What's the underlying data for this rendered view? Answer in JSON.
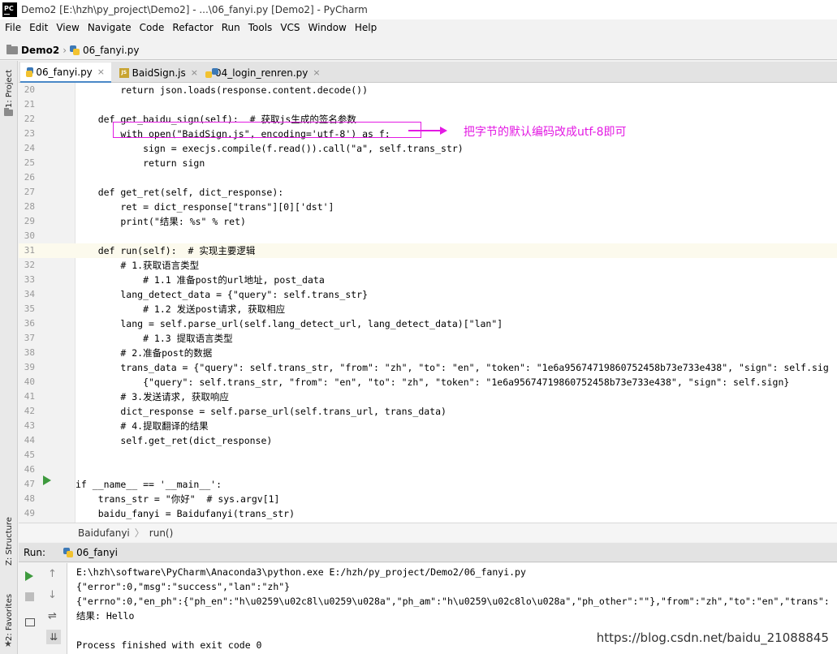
{
  "window": {
    "title": "Demo2 [E:\\hzh\\py_project\\Demo2] - ...\\06_fanyi.py [Demo2] - PyCharm"
  },
  "menu": [
    "File",
    "Edit",
    "View",
    "Navigate",
    "Code",
    "Refactor",
    "Run",
    "Tools",
    "VCS",
    "Window",
    "Help"
  ],
  "breadcrumb": {
    "project": "Demo2",
    "file": "06_fanyi.py"
  },
  "side_tools": {
    "project": "1: Project",
    "structure": "Z: Structure",
    "favorites": "2: Favorites"
  },
  "tabs": [
    {
      "label": "06_fanyi.py",
      "close": "×"
    },
    {
      "label": "BaidSign.js",
      "close": "×"
    },
    {
      "label": "04_login_renren.py",
      "close": "×"
    }
  ],
  "code_lines": [
    {
      "n": "20",
      "text": "        return json.loads(response.content.decode())"
    },
    {
      "n": "21",
      "text": ""
    },
    {
      "n": "22",
      "text": "    def get_baidu_sign(self):  # 获取js生成的签名参数"
    },
    {
      "n": "23",
      "text": "        with open(\"BaidSign.js\", encoding='utf-8') as f:"
    },
    {
      "n": "24",
      "text": "            sign = execjs.compile(f.read()).call(\"a\", self.trans_str)"
    },
    {
      "n": "25",
      "text": "            return sign"
    },
    {
      "n": "26",
      "text": ""
    },
    {
      "n": "27",
      "text": "    def get_ret(self, dict_response):"
    },
    {
      "n": "28",
      "text": "        ret = dict_response[\"trans\"][0]['dst']"
    },
    {
      "n": "29",
      "text": "        print(\"结果: %s\" % ret)"
    },
    {
      "n": "30",
      "text": ""
    },
    {
      "n": "31",
      "text": "    def run(self):  # 实现主要逻辑"
    },
    {
      "n": "32",
      "text": "        # 1.获取语言类型"
    },
    {
      "n": "33",
      "text": "            # 1.1 准备post的url地址, post_data"
    },
    {
      "n": "34",
      "text": "        lang_detect_data = {\"query\": self.trans_str}"
    },
    {
      "n": "35",
      "text": "            # 1.2 发送post请求, 获取相应"
    },
    {
      "n": "36",
      "text": "        lang = self.parse_url(self.lang_detect_url, lang_detect_data)[\"lan\"]"
    },
    {
      "n": "37",
      "text": "            # 1.3 提取语言类型"
    },
    {
      "n": "38",
      "text": "        # 2.准备post的数据"
    },
    {
      "n": "39",
      "text": "        trans_data = {\"query\": self.trans_str, \"from\": \"zh\", \"to\": \"en\", \"token\": \"1e6a95674719860752458b73e733e438\", \"sign\": self.sig"
    },
    {
      "n": "40",
      "text": "            {\"query\": self.trans_str, \"from\": \"en\", \"to\": \"zh\", \"token\": \"1e6a95674719860752458b73e733e438\", \"sign\": self.sign}"
    },
    {
      "n": "41",
      "text": "        # 3.发送请求, 获取响应"
    },
    {
      "n": "42",
      "text": "        dict_response = self.parse_url(self.trans_url, trans_data)"
    },
    {
      "n": "43",
      "text": "        # 4.提取翻译的结果"
    },
    {
      "n": "44",
      "text": "        self.get_ret(dict_response)"
    },
    {
      "n": "45",
      "text": ""
    },
    {
      "n": "46",
      "text": ""
    },
    {
      "n": "47",
      "text": "if __name__ == '__main__':"
    },
    {
      "n": "48",
      "text": "    trans_str = \"你好\"  # sys.argv[1]"
    },
    {
      "n": "49",
      "text": "    baidu_fanyi = Baidufanyi(trans_str)"
    }
  ],
  "annotation": {
    "text": "把字节的默认编码改成utf-8即可",
    "color": "#e31ae3"
  },
  "code_breadcrumb": {
    "class": "Baidufanyi",
    "method": "run()"
  },
  "run_panel": {
    "label": "Run:",
    "config": "06_fanyi",
    "output": [
      "E:\\hzh\\software\\PyCharm\\Anaconda3\\python.exe E:/hzh/py_project/Demo2/06_fanyi.py",
      "{\"error\":0,\"msg\":\"success\",\"lan\":\"zh\"}",
      "{\"errno\":0,\"en_ph\":{\"ph_en\":\"h\\u0259\\u02c8l\\u0259\\u028a\",\"ph_am\":\"h\\u0259\\u02c8lo\\u028a\",\"ph_other\":\"\"},\"from\":\"zh\",\"to\":\"en\",\"trans\":",
      "结果: Hello",
      "",
      "Process finished with exit code 0"
    ]
  },
  "watermark": "https://blog.csdn.net/baidu_21088845"
}
